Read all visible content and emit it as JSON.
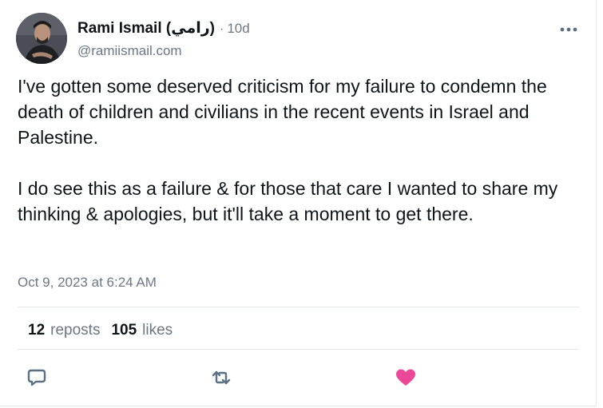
{
  "post": {
    "author": {
      "display_name": "Rami Ismail (رامي)",
      "separator": "·",
      "relative_time": "10d",
      "handle": "@ramiismail.com"
    },
    "body": {
      "paragraph_1": "I've gotten some deserved criticism for my failure to condemn the death of children and civilians in the recent events in Israel and Palestine.",
      "paragraph_2": "I do see this as a failure & for those that care I wanted to share my thinking & apologies, but it'll take a moment to get there."
    },
    "date": "Oct 9, 2023 at 6:24 AM",
    "stats": {
      "reposts_count": "12",
      "reposts_label": "reposts",
      "likes_count": "105",
      "likes_label": "likes"
    },
    "actions": {
      "reply_icon": "speech-bubble-icon",
      "repost_icon": "repost-arrows-icon",
      "like_icon": "heart-icon",
      "more_icon": "ellipsis-icon"
    }
  },
  "colors": {
    "text_primary": "#0f1419",
    "text_secondary": "#6b7785",
    "divider": "#e6e9ec",
    "action_icon": "#5b7083",
    "like_active": "#ec4899"
  }
}
